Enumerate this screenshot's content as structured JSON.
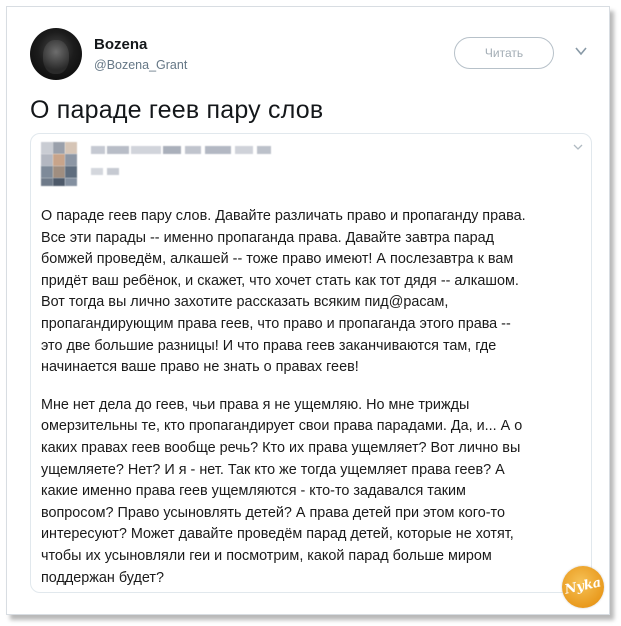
{
  "author": {
    "name": "Bozena",
    "handle": "@Bozena_Grant"
  },
  "follow_button_label": "Читать",
  "tweet": {
    "text": "О параде геев пару слов"
  },
  "quote": {
    "paragraph1": [
      "О параде геев пару слов. Давайте различать право и пропаганду права.",
      "Все эти парады -- именно пропаганда права. Давайте завтра парад",
      "бомжей проведём, алкашей -- тоже право имеют! А послезавтра к вам",
      "придёт ваш ребёнок, и скажет, что хочет стать как тот дядя -- алкашом.",
      "Вот тогда вы лично захотите рассказать всяким пид@расам,",
      "пропагандирующим права геев, что право и пропаганда этого права --",
      "это две большие разницы! И что права геев заканчиваются там, где",
      "начинается ваше право не знать о правах геев!"
    ],
    "paragraph2": [
      "Мне нет дела до геев, чьи права я не ущемляю. Но мне трижды",
      "омерзительны те, кто пропагандирует свои права парадами. Да, и... А о",
      "каких правах геев вообще речь? Кто их права ущемляет? Вот лично вы",
      "ущемляете? Нет? И я - нет. Так кто же тогда ущемляет права геев? А",
      "какие именно права геев ущемляются - кто-то задавался таким",
      "вопросом? Право усыновлять детей? А права детей при этом кого-то",
      "интересуют? Может давайте проведём парад детей, которые не хотят,",
      "чтобы их усыновляли геи и посмотрим, какой парад больше миром",
      "поддержан будет?"
    ]
  },
  "watermark_text": "Nyka",
  "icons": [
    "caret-down-icon",
    "quote-caret-icon"
  ],
  "colors": {
    "handle": "#657786",
    "follow_border": "#b7c1c9",
    "follow_text": "#a3adb5",
    "card_border": "#e1e8ed",
    "watermark": "#e99a1e"
  }
}
